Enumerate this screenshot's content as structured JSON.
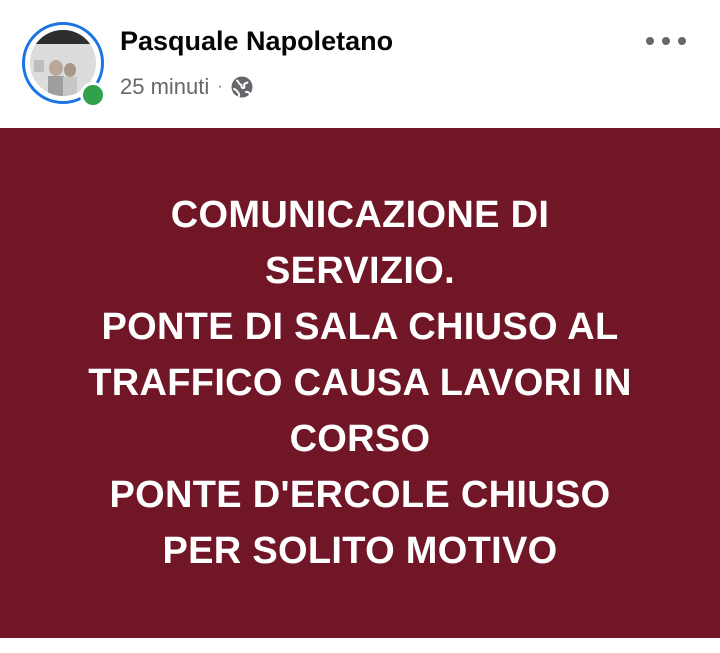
{
  "post": {
    "author": "Pasquale Napoletano",
    "timestamp": "25 minuti",
    "separator": "·",
    "privacy_icon": "globe-icon",
    "more_icon": "more-options-icon",
    "background_color": "#701627",
    "text_color": "#ffffff",
    "online_status_color": "#31a24c",
    "avatar_ring_color": "#1b74e4",
    "text": "COMUNICAZIONE DI\nSERVIZIO.\nPONTE DI SALA CHIUSO AL\nTRAFFICO CAUSA LAVORI IN\nCORSO\nPONTE D'ERCOLE CHIUSO\nPER SOLITO MOTIVO"
  }
}
